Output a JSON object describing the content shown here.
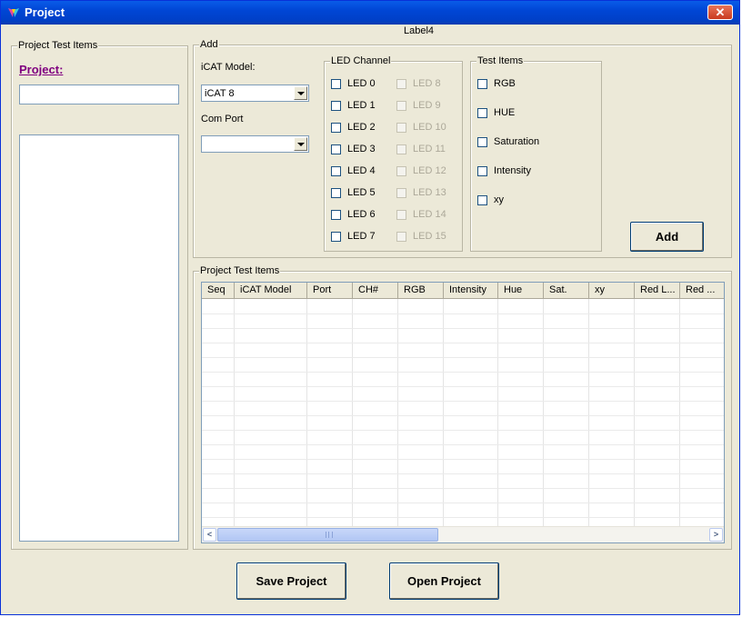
{
  "window": {
    "title": "Project",
    "close_label": "✕"
  },
  "label4": "Label4",
  "left_panel": {
    "group_title": "Project Test Items",
    "project_label": "Project:",
    "project_input_value": ""
  },
  "add_group": {
    "title": "Add",
    "icat_model_label": "iCAT Model:",
    "icat_model_value": "iCAT 8",
    "com_port_label": "Com Port",
    "com_port_value": "",
    "add_button": "Add"
  },
  "led_channel": {
    "title": "LED Channel",
    "left": [
      "LED 0",
      "LED 1",
      "LED 2",
      "LED 3",
      "LED 4",
      "LED 5",
      "LED 6",
      "LED 7"
    ],
    "right": [
      "LED 8",
      "LED 9",
      "LED 10",
      "LED 11",
      "LED 12",
      "LED 13",
      "LED 14",
      "LED 15"
    ]
  },
  "test_items": {
    "title": "Test Items",
    "items": [
      "RGB",
      "HUE",
      "Saturation",
      "Intensity",
      "xy"
    ]
  },
  "grid_group": {
    "title": "Project Test Items",
    "columns": [
      "Seq",
      "iCAT Model",
      "Port",
      "CH#",
      "RGB",
      "Intensity",
      "Hue",
      "Sat.",
      "xy",
      "Red L...",
      "Red ..."
    ],
    "scroll_grip": "III"
  },
  "buttons": {
    "save": "Save Project",
    "open": "Open Project"
  },
  "colors": {
    "titlebar": "#0054e3",
    "window_bg": "#ece9d8",
    "project_link": "#800080"
  }
}
